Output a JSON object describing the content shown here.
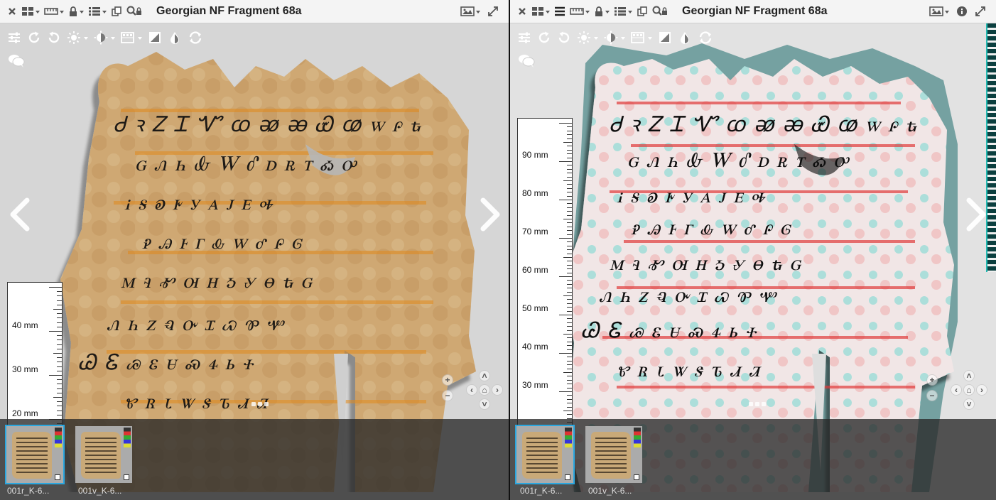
{
  "left_window": {
    "title": "Georgian NF Fragment 68a",
    "ruler_labels": [
      "40 mm",
      "30 mm",
      "20 mm"
    ],
    "thumbnails": [
      {
        "label": "001r_K-6...",
        "selected": true
      },
      {
        "label": "001v_K-6...",
        "selected": false
      }
    ]
  },
  "right_window": {
    "title": "Georgian NF Fragment 68a",
    "ruler_labels": [
      "90 mm",
      "80 mm",
      "70 mm",
      "60 mm",
      "50 mm",
      "40 mm",
      "30 mm"
    ],
    "thumbnails": [
      {
        "label": "001r_K-6...",
        "selected": true
      },
      {
        "label": "001v_K-6...",
        "selected": false
      }
    ]
  },
  "colors": {
    "toolbar_bg": "#f4f4f4",
    "selected_thumb": "#2aa7e0",
    "parchment": "#c9a978",
    "ink": "#1e1a16",
    "rubric": "#c8401e",
    "enhanced_cyan": "#22b8b0"
  },
  "icons": {
    "toolbar": [
      "close-icon",
      "layout-grid-icon",
      "ruler-icon",
      "lock-icon",
      "list-view-icon",
      "sync-icon",
      "search-icon"
    ],
    "right_only": [
      "menu-hamburger-icon",
      "info-icon"
    ],
    "canvas_tools": [
      "adjust-sliders-icon",
      "rotate-right-icon",
      "rotate-left-icon",
      "brightness-icon",
      "contrast-icon",
      "grayscale-icon",
      "invert-icon",
      "threshold-icon",
      "reset-icon"
    ],
    "comment": "comment-icon",
    "image_menu": "image-icon",
    "fullscreen": "fullscreen-icon"
  }
}
